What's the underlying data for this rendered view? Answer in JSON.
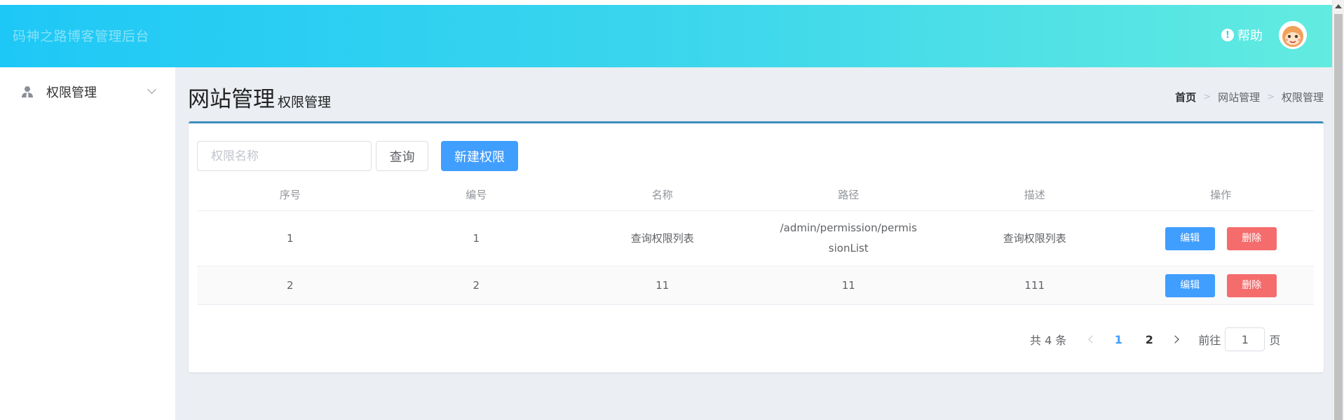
{
  "header": {
    "app_title": "码神之路博客管理后台",
    "help_label": "帮助",
    "help_icon": "exclamation-circle-icon",
    "accent": "#1ec8f6"
  },
  "sidebar": {
    "items": [
      {
        "label": "权限管理",
        "icon": "user-tie-icon"
      }
    ]
  },
  "page": {
    "title": "网站管理",
    "subtitle": "权限管理"
  },
  "breadcrumb": {
    "items": [
      "首页",
      "网站管理",
      "权限管理"
    ]
  },
  "toolbar": {
    "search_placeholder": "权限名称",
    "query_label": "查询",
    "new_label": "新建权限",
    "primary_color": "#409eff",
    "danger_color": "#f56c6c"
  },
  "table": {
    "columns": [
      "序号",
      "编号",
      "名称",
      "路径",
      "描述",
      "操作"
    ],
    "rows": [
      {
        "index": "1",
        "id": "1",
        "name": "查询权限列表",
        "path": "/admin/permission/permissionList",
        "desc": "查询权限列表",
        "edit_label": "编辑",
        "delete_label": "删除"
      },
      {
        "index": "2",
        "id": "2",
        "name": "11",
        "path": "11",
        "desc": "111",
        "edit_label": "编辑",
        "delete_label": "删除"
      }
    ]
  },
  "pagination": {
    "total_text": "共 4 条",
    "pages": [
      "1",
      "2"
    ],
    "current_page": "1",
    "goto_prefix": "前往",
    "goto_suffix": "页"
  }
}
